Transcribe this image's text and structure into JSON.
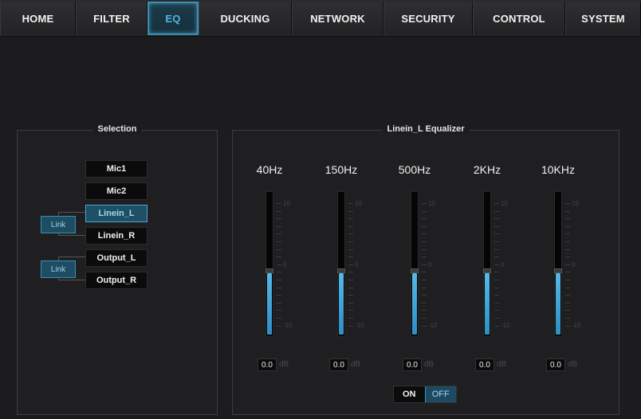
{
  "tabs": [
    {
      "label": "HOME"
    },
    {
      "label": "FILTER"
    },
    {
      "label": "EQ"
    },
    {
      "label": "DUCKING"
    },
    {
      "label": "NETWORK"
    },
    {
      "label": "SECURITY"
    },
    {
      "label": "CONTROL"
    },
    {
      "label": "SYSTEM"
    }
  ],
  "active_tab": "EQ",
  "selection": {
    "title": "Selection",
    "items": [
      {
        "label": "Mic1"
      },
      {
        "label": "Mic2"
      },
      {
        "label": "Linein_L"
      },
      {
        "label": "Linein_R"
      },
      {
        "label": "Output_L"
      },
      {
        "label": "Output_R"
      }
    ],
    "selected": "Linein_L",
    "link_labels": [
      "Link",
      "Link"
    ]
  },
  "equalizer": {
    "title": "Linein_L Equalizer",
    "scale_max": "10",
    "scale_mid": "0",
    "scale_min": "-10",
    "bands": [
      {
        "freq": "40Hz",
        "value": "0.0",
        "unit": "dB",
        "level": 0.5
      },
      {
        "freq": "150Hz",
        "value": "0.0",
        "unit": "dB",
        "level": 0.5
      },
      {
        "freq": "500Hz",
        "value": "0.0",
        "unit": "dB",
        "level": 0.5
      },
      {
        "freq": "2KHz",
        "value": "0.0",
        "unit": "dB",
        "level": 0.5
      },
      {
        "freq": "10KHz",
        "value": "0.0",
        "unit": "dB",
        "level": 0.5
      }
    ],
    "toggle": {
      "on_label": "ON",
      "off_label": "OFF",
      "state": "OFF"
    }
  },
  "colors": {
    "accent": "#4fb6dc",
    "fill": "#3aa3d8",
    "background": "#1c1c1e"
  }
}
